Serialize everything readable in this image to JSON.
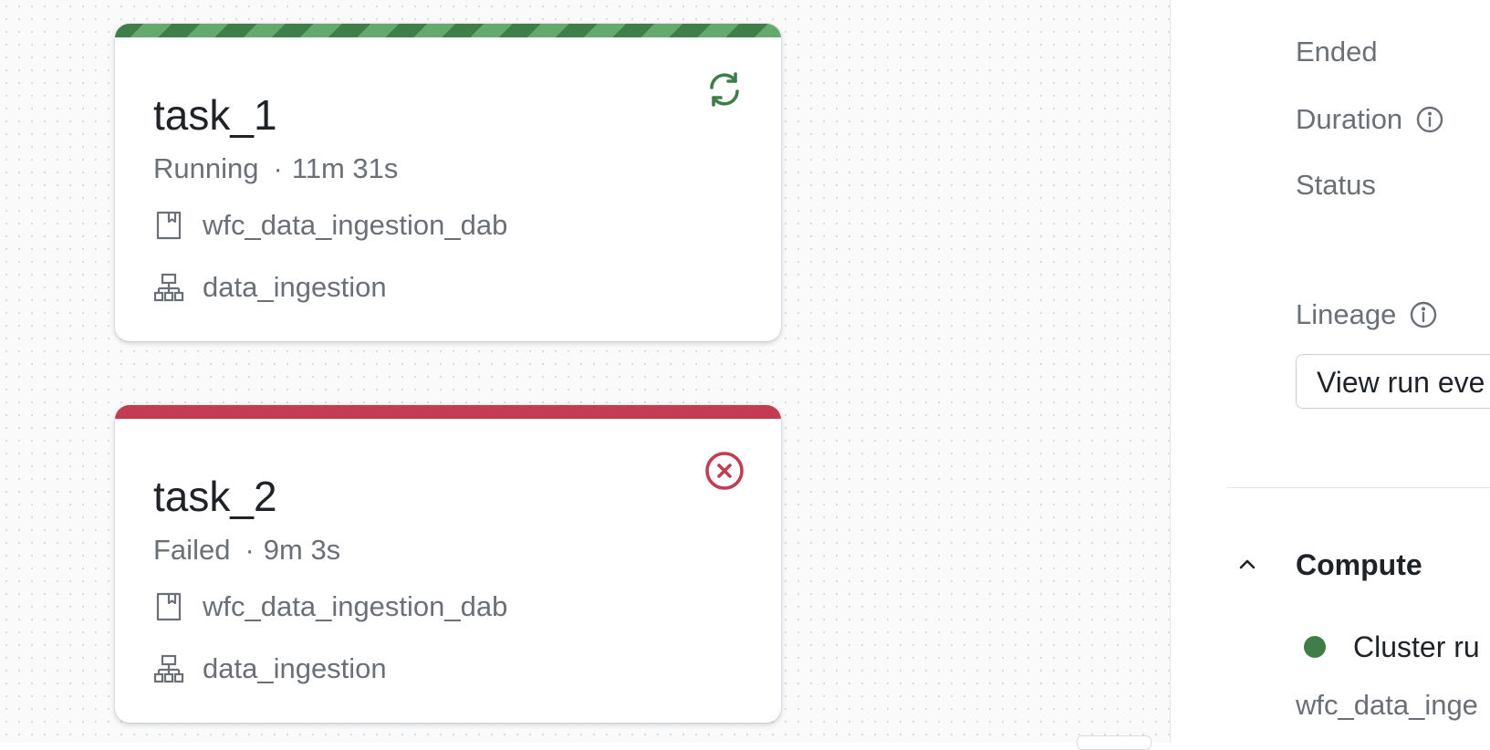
{
  "tasks": [
    {
      "name": "task_1",
      "status": "Running",
      "duration": "11m 31s",
      "notebook": "wfc_data_ingestion_dab",
      "cluster": "data_ingestion",
      "status_icon": "refresh-icon",
      "color": "#3f7d49"
    },
    {
      "name": "task_2",
      "status": "Failed",
      "duration": "9m 3s",
      "notebook": "wfc_data_ingestion_dab",
      "cluster": "data_ingestion",
      "status_icon": "error-icon",
      "color": "#c23d51"
    }
  ],
  "separator": "·",
  "details": {
    "ended_label": "Ended",
    "duration_label": "Duration",
    "status_label": "Status",
    "lineage_label": "Lineage",
    "view_button": "View run eve"
  },
  "compute": {
    "title": "Compute",
    "cluster_status": "Cluster ru",
    "cluster_name": "wfc_data_inge",
    "status_color": "#3f7d49"
  }
}
